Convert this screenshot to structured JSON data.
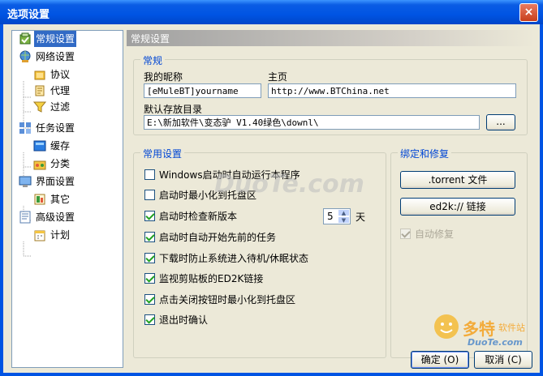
{
  "window": {
    "title": "选项设置",
    "close": "×"
  },
  "tree": {
    "items": [
      {
        "label": "常规设置",
        "icon": "general-settings-icon"
      },
      {
        "label": "网络设置",
        "icon": "network-icon"
      },
      {
        "label": "协议",
        "icon": "protocol-icon"
      },
      {
        "label": "代理",
        "icon": "proxy-icon"
      },
      {
        "label": "过滤",
        "icon": "filter-icon"
      },
      {
        "label": "任务设置",
        "icon": "task-icon"
      },
      {
        "label": "缓存",
        "icon": "cache-icon"
      },
      {
        "label": "分类",
        "icon": "category-icon"
      },
      {
        "label": "界面设置",
        "icon": "interface-icon"
      },
      {
        "label": "其它",
        "icon": "other-icon"
      },
      {
        "label": "高级设置",
        "icon": "advanced-icon"
      },
      {
        "label": "计划",
        "icon": "schedule-icon"
      }
    ]
  },
  "header": {
    "title": "常规设置"
  },
  "general": {
    "group_label": "常规",
    "nickname_label": "我的昵称",
    "nickname_value": "[eMuleBT]yourname",
    "homepage_label": "主页",
    "homepage_value": "http://www.BTChina.net",
    "dir_label": "默认存放目录",
    "dir_value": "E:\\新加软件\\变态驴 V1.40绿色\\downl\\",
    "browse_label": "..."
  },
  "common": {
    "group_label": "常用设置",
    "options": [
      {
        "label": "Windows启动时自动运行本程序",
        "checked": false
      },
      {
        "label": "启动时最小化到托盘区",
        "checked": false
      },
      {
        "label": "启动时检查新版本",
        "checked": true
      },
      {
        "label": "启动时自动开始先前的任务",
        "checked": true
      },
      {
        "label": "下载时防止系统进入待机/休眠状态",
        "checked": true
      },
      {
        "label": "监视剪贴板的ED2K链接",
        "checked": true
      },
      {
        "label": "点击关闭按钮时最小化到托盘区",
        "checked": true
      },
      {
        "label": "退出时确认",
        "checked": true
      }
    ],
    "days_value": "5",
    "days_unit": "天"
  },
  "bind": {
    "group_label": "绑定和修复",
    "torrent_button": ".torrent 文件",
    "ed2k_button": "ed2k:// 链接",
    "autofix_label": "自动修复",
    "autofix_checked": true
  },
  "footer": {
    "ok": "确定 (O)",
    "cancel": "取消 (C)"
  },
  "watermark": {
    "top": "DuoTe.com",
    "logo": "多特",
    "logo_sub": "软件站",
    "bottom": "DuoTe.com"
  }
}
